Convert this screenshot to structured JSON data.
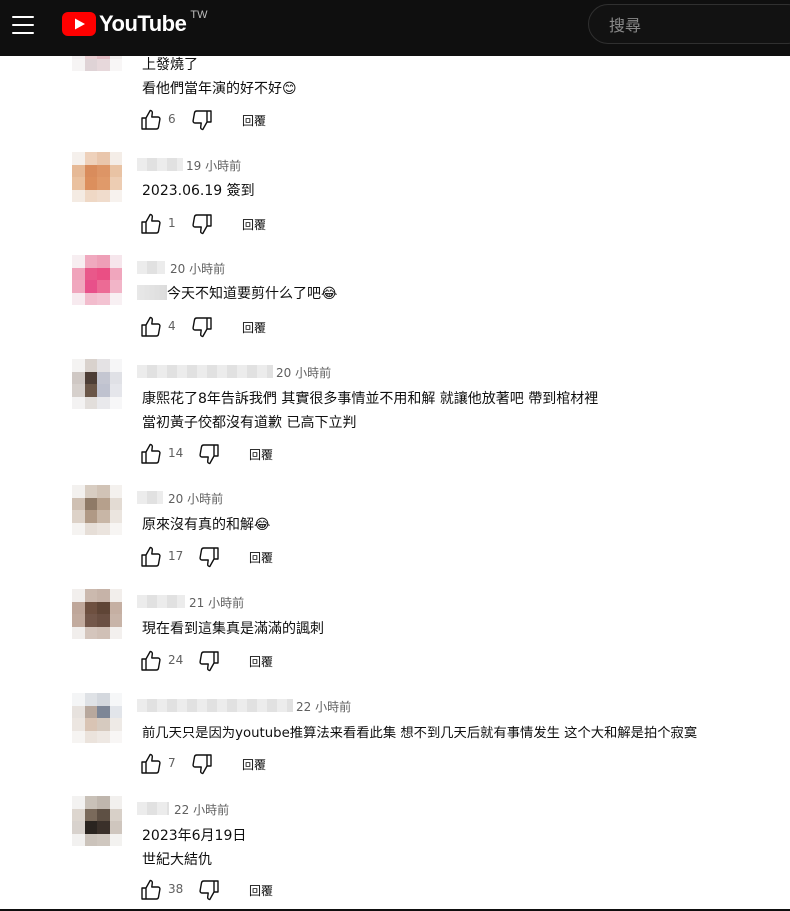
{
  "header": {
    "brand": "YouTube",
    "region": "TW",
    "search_placeholder": "搜尋"
  },
  "comments": [
    {
      "time": "",
      "lines": [
        "上發燒了",
        "看他們當年演的好不好😊"
      ],
      "likes": "6",
      "reply_label": "回覆"
    },
    {
      "time": "19 小時前",
      "lines": [
        "2023.06.19 簽到"
      ],
      "likes": "1",
      "reply_label": "回覆"
    },
    {
      "time": "20 小時前",
      "lines": [
        "今天不知道要剪什么了吧😂"
      ],
      "likes": "4",
      "reply_label": "回覆"
    },
    {
      "time": "20 小時前",
      "lines": [
        "康熙花了8年告訴我們 其實很多事情並不用和解 就讓他放著吧 帶到棺材裡",
        "當初黃子佼都沒有道歉 已高下立判"
      ],
      "likes": "14",
      "reply_label": "回覆"
    },
    {
      "time": "20 小時前",
      "lines": [
        "原來沒有真的和解😂"
      ],
      "likes": "17",
      "reply_label": "回覆"
    },
    {
      "time": "21 小時前",
      "lines": [
        "現在看到這集真是滿滿的諷刺"
      ],
      "likes": "24",
      "reply_label": "回覆"
    },
    {
      "time": "22 小時前",
      "lines": [
        "前几天只是因为youtube推算法来看看此集 想不到几天后就有事情发生 这个大和解是拍个寂寞"
      ],
      "likes": "7",
      "reply_label": "回覆"
    },
    {
      "time": "22 小時前",
      "lines": [
        "2023年6月19日",
        "世紀大結仇"
      ],
      "likes": "38",
      "reply_label": "回覆"
    }
  ]
}
